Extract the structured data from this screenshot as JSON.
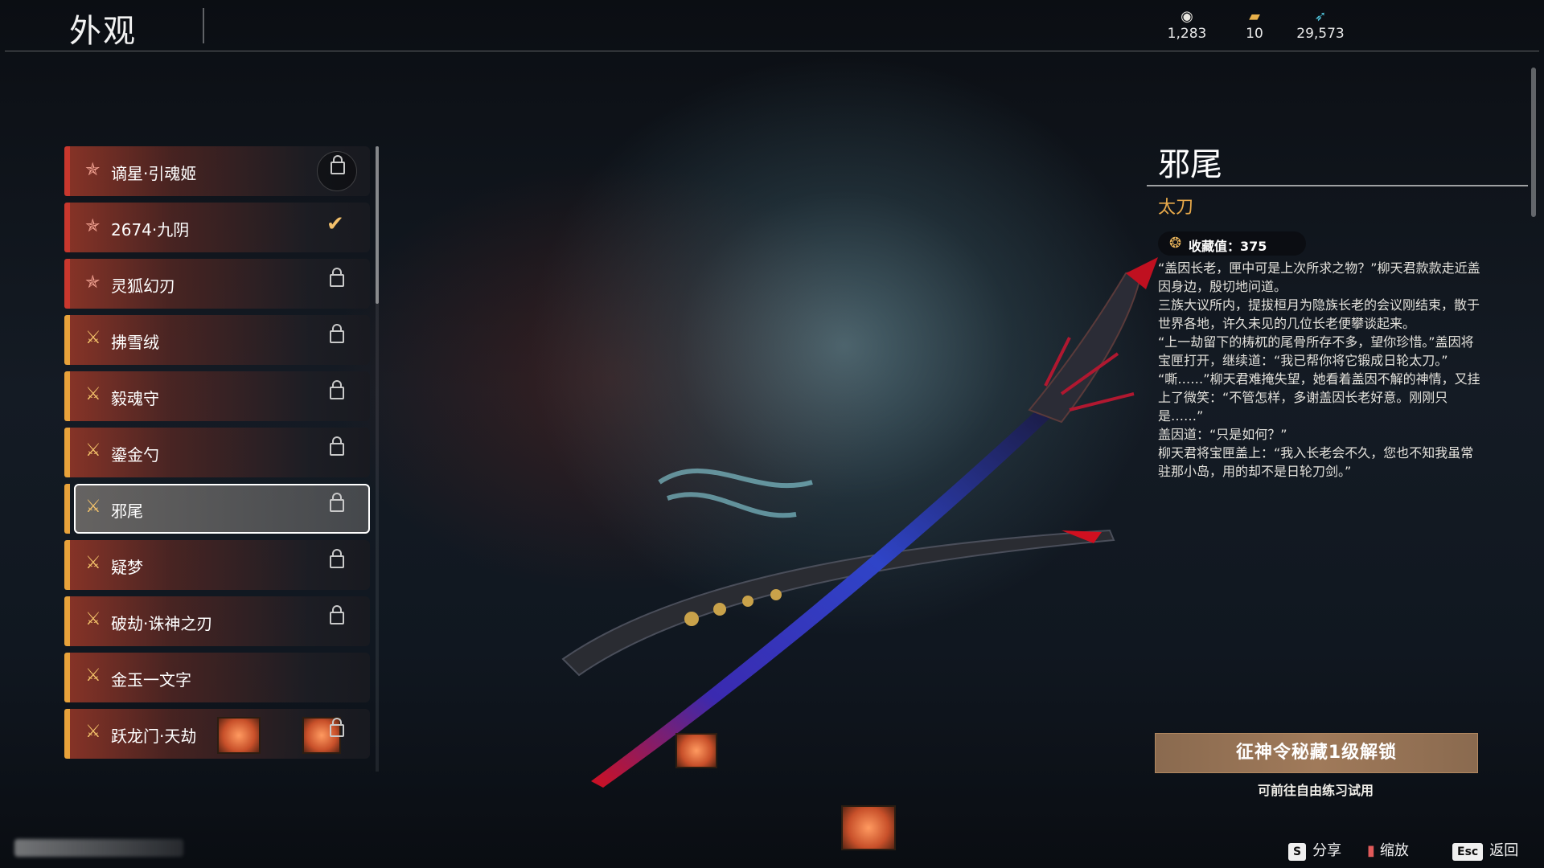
{
  "header": {
    "title": "外观",
    "currencies": [
      {
        "icon": "coin-icon",
        "value": "1,283"
      },
      {
        "icon": "ticket-icon",
        "value": "10"
      },
      {
        "icon": "feather-icon",
        "value": "29,573"
      }
    ]
  },
  "list": {
    "items": [
      {
        "name": "谪星·引魂姬",
        "rarity": "red",
        "status": "locked-badge"
      },
      {
        "name": "2674·九阴",
        "rarity": "red",
        "status": "owned"
      },
      {
        "name": "灵狐幻刃",
        "rarity": "red",
        "status": "locked"
      },
      {
        "name": "拂雪绒",
        "rarity": "gold",
        "status": "locked"
      },
      {
        "name": "毅魂守",
        "rarity": "gold",
        "status": "locked"
      },
      {
        "name": "鎏金勺",
        "rarity": "gold",
        "status": "locked"
      },
      {
        "name": "邪尾",
        "rarity": "gold",
        "status": "locked",
        "selected": true
      },
      {
        "name": "疑梦",
        "rarity": "gold",
        "status": "locked"
      },
      {
        "name": "破劫·诛神之刃",
        "rarity": "gold",
        "status": "locked"
      },
      {
        "name": "金玉一文字",
        "rarity": "gold",
        "status": "none"
      },
      {
        "name": "跃龙门·天劫",
        "rarity": "gold",
        "status": "locked"
      }
    ]
  },
  "detail": {
    "name": "邪尾",
    "type": "太刀",
    "collection_label": "收藏值：375",
    "story": "“盖因长老，匣中可是上次所求之物？”柳天君款款走近盖因身边，殷切地问道。\n三族大议所内，提拔桓月为隐族长老的会议刚结束，散于世界各地，许久未见的几位长老便攀谈起来。\n“上一劫留下的梼杌的尾骨所存不多，望你珍惜。”盖因将宝匣打开，继续道：“我已帮你将它锻成日轮太刀。”\n“嘶……”柳天君难掩失望，她看着盖因不解的神情，又挂上了微笑：“不管怎样，多谢盖因长老好意。刚刚只是……”\n盖因道：“只是如何？”\n柳天君将宝匣盖上：“我入长老会不久，您也不知我虽常驻那小岛，用的却不是日轮刀剑。”",
    "unlock_button": "征神令秘藏1级解锁",
    "unlock_note": "可前往自由练习试用"
  },
  "footer": {
    "share_key": "S",
    "share_label": "分享",
    "zoom_label": "缩放",
    "back_key": "Esc",
    "back_label": "返回"
  },
  "colors": {
    "red_rarity": "#c8372d",
    "gold_rarity": "#e8a23a",
    "accent": "#e8a94a"
  }
}
